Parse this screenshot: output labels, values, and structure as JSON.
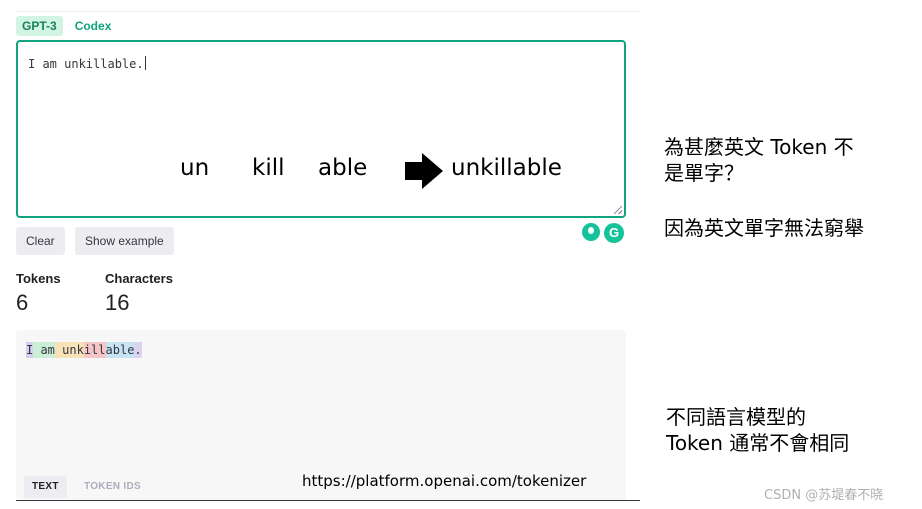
{
  "tabs": [
    "GPT-3",
    "Codex"
  ],
  "editor": {
    "value": "I am unkillable."
  },
  "breakdown": {
    "pieces": [
      "un",
      "kill",
      "able"
    ],
    "result": "unkillable"
  },
  "buttons": {
    "clear": "Clear",
    "show_example": "Show example"
  },
  "stats": {
    "tokens_label": "Tokens",
    "tokens_value": "6",
    "characters_label": "Characters",
    "characters_value": "16"
  },
  "output": {
    "tokens": [
      "I",
      " am",
      " unk",
      "ill",
      "able",
      "."
    ],
    "tab_text": "TEXT",
    "tab_ids": "TOKEN IDS",
    "url": "https://platform.openai.com/tokenizer"
  },
  "notes": {
    "question_line1": "為甚麼英文 Token 不",
    "question_line2": "是單字？",
    "answer": "因為英文單字無法窮舉",
    "diff_line1": "不同語言模型的",
    "diff_line2": "Token 通常不會相同"
  },
  "watermark": "CSDN @苏堤春不晓",
  "colors": {
    "accent": "#10a37f",
    "grammarly": "#15c39a"
  }
}
